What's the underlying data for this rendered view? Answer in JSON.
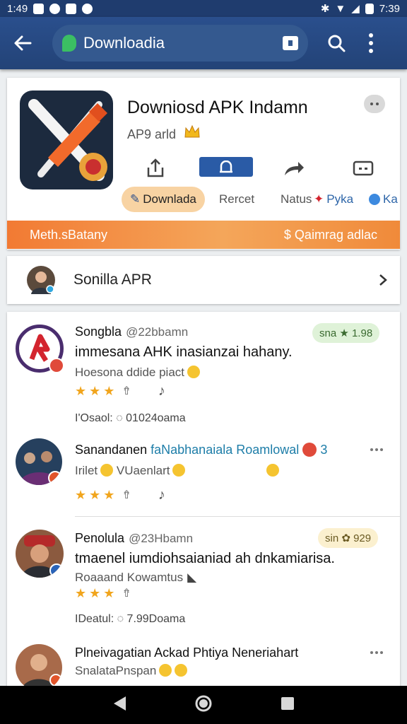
{
  "status_bar": {
    "time": "1:49",
    "clock": "7:39"
  },
  "app_bar": {
    "url_text": "Downloadia"
  },
  "app": {
    "title": "Downiosd APK Indamn",
    "subtitle": "AP9 arld",
    "tags": [
      "Downlada",
      "Rercet",
      "Natus",
      "Pyka",
      "Ka"
    ],
    "banner_left": "Meth.sBatany",
    "banner_right": "$ Qaimrag adlac"
  },
  "section": {
    "title": "Sonilla APR"
  },
  "reviews": [
    {
      "name": "Songbla",
      "handle": "@22bbamn",
      "badge": "sna ★ 1.98",
      "body": "immesana AHK inasianzai hahany.",
      "sub": "Hoesona ddide piact",
      "foot": "I'Osaol: ◌ 01024oama"
    },
    {
      "name": "Sanandanen",
      "name2": "faNabhanaiala",
      "name3": "Roamlowal",
      "badge": "3",
      "body": "Irilet",
      "body2": "VUaenlart",
      "stars": 3
    },
    {
      "name": "Penolula",
      "handle": "@23Hbamn",
      "badge": "sin ✿ 929",
      "body": "tmaenel iumdiohsaianiad ah dnkamiarisa.",
      "sub": "Roaaand Kowamtus",
      "foot": "IDeatul: ◌ 7.99Doama"
    },
    {
      "name": "Plneivagatian Ackad Phtiya Neneriahart",
      "sub": "SnalataPnspan"
    }
  ]
}
